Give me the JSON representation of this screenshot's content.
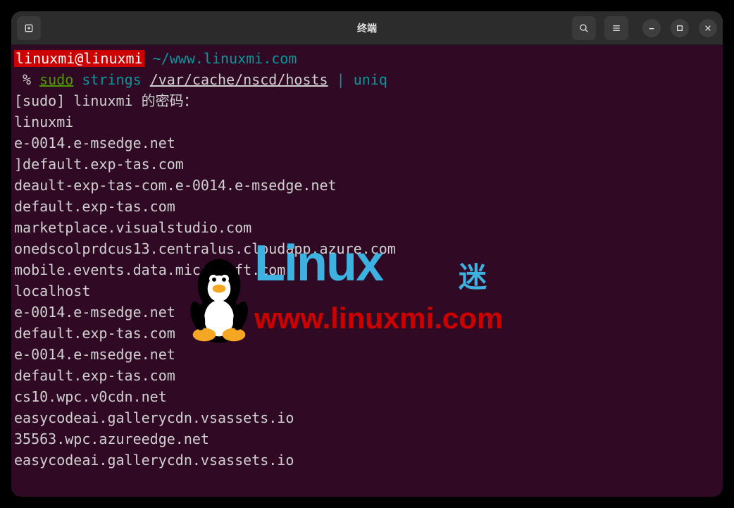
{
  "window": {
    "title": "终端"
  },
  "prompt": {
    "user_host": "linuxmi@linuxmi",
    "path": "~/www.linuxmi.com",
    "symbol": "%",
    "cmd_sudo": "sudo",
    "cmd_strings": "strings",
    "cmd_arg": "/var/cache/nscd/hosts",
    "cmd_pipe": "|",
    "cmd_uniq": "uniq"
  },
  "output": [
    "[sudo] linuxmi 的密码：",
    "linuxmi",
    "e-0014.e-msedge.net",
    "]default.exp-tas.com",
    "deault-exp-tas-com.e-0014.e-msedge.net",
    "default.exp-tas.com",
    "marketplace.visualstudio.com",
    "onedscolprdcus13.centralus.cloudapp.azure.com",
    "mobile.events.data.microsoft.com",
    "localhost",
    "e-0014.e-msedge.net",
    "default.exp-tas.com",
    "e-0014.e-msedge.net",
    "default.exp-tas.com",
    "cs10.wpc.v0cdn.net",
    "easycodeai.gallerycdn.vsassets.io",
    "35563.wpc.azureedge.net",
    "easycodeai.gallerycdn.vsassets.io"
  ],
  "watermark": {
    "brand": "Linux",
    "cn": "迷",
    "url": "www.linuxmi.com"
  }
}
